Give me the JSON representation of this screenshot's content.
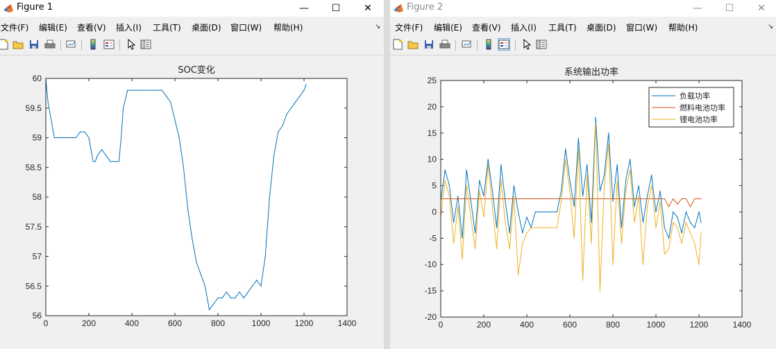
{
  "figure1": {
    "title": "Figure 1",
    "controls": {
      "minimize": "—",
      "maximize": "☐",
      "close": "✕"
    },
    "menu": [
      "文件(F)",
      "编辑(E)",
      "查看(V)",
      "插入(I)",
      "工具(T)",
      "桌面(D)",
      "窗口(W)",
      "帮助(H)"
    ],
    "toolbar_icons": [
      "new-file-icon",
      "open-folder-icon",
      "save-icon",
      "print-icon",
      "link-plot-icon",
      "colorbar-icon",
      "legend-icon",
      "edit-plot-arrow-icon",
      "property-inspector-icon"
    ]
  },
  "figure2": {
    "title": "Figure 2",
    "controls": {
      "minimize": "—",
      "maximize": "☐",
      "close": "✕"
    },
    "menu": [
      "文件(F)",
      "编辑(E)",
      "查看(V)",
      "插入(I)",
      "工具(T)",
      "桌面(D)",
      "窗口(W)",
      "帮助(H)"
    ],
    "toolbar_icons": [
      "new-file-icon",
      "open-folder-icon",
      "save-icon",
      "print-icon",
      "link-plot-icon",
      "colorbar-icon",
      "legend-icon",
      "edit-plot-arrow-icon",
      "property-inspector-icon"
    ]
  },
  "chart_data": [
    {
      "type": "line",
      "title": "SOC变化",
      "xlabel": "",
      "ylabel": "",
      "xlim": [
        0,
        1400
      ],
      "ylim": [
        56,
        60
      ],
      "xticks": [
        "0",
        "200",
        "400",
        "600",
        "800",
        "1000",
        "1200",
        "1400"
      ],
      "yticks": [
        "56",
        "56.5",
        "57",
        "57.5",
        "58",
        "58.5",
        "59",
        "59.5",
        "60"
      ],
      "grid": false,
      "series": [
        {
          "color": "#0072BD",
          "x": [
            0,
            5,
            10,
            20,
            40,
            80,
            100,
            120,
            140,
            160,
            180,
            200,
            210,
            220,
            230,
            240,
            260,
            280,
            300,
            320,
            340,
            350,
            360,
            380,
            400,
            450,
            500,
            540,
            560,
            580,
            600,
            620,
            640,
            660,
            680,
            700,
            720,
            740,
            760,
            780,
            800,
            820,
            840,
            860,
            880,
            900,
            920,
            940,
            960,
            980,
            1000,
            1020,
            1040,
            1060,
            1080,
            1100,
            1120,
            1140,
            1160,
            1180,
            1200,
            1210
          ],
          "y": [
            60,
            59.8,
            59.6,
            59.4,
            59.0,
            59.0,
            59.0,
            59.0,
            59.0,
            59.1,
            59.1,
            59.0,
            58.8,
            58.6,
            58.6,
            58.7,
            58.8,
            58.7,
            58.6,
            58.6,
            58.6,
            59.0,
            59.5,
            59.8,
            59.8,
            59.8,
            59.8,
            59.8,
            59.7,
            59.6,
            59.3,
            59.0,
            58.5,
            57.8,
            57.3,
            56.9,
            56.7,
            56.5,
            56.1,
            56.2,
            56.3,
            56.3,
            56.4,
            56.3,
            56.3,
            56.4,
            56.3,
            56.4,
            56.5,
            56.6,
            56.5,
            57.0,
            58.0,
            58.7,
            59.1,
            59.2,
            59.4,
            59.5,
            59.6,
            59.7,
            59.8,
            59.9
          ]
        }
      ]
    },
    {
      "type": "line",
      "title": "系统输出功率",
      "xlabel": "",
      "ylabel": "",
      "xlim": [
        0,
        1400
      ],
      "ylim": [
        -20,
        25
      ],
      "xticks": [
        "0",
        "200",
        "400",
        "600",
        "800",
        "1000",
        "1200",
        "1400"
      ],
      "yticks": [
        "-20",
        "-15",
        "-10",
        "-5",
        "0",
        "5",
        "10",
        "15",
        "20",
        "25"
      ],
      "grid": false,
      "legend_position": "top-right",
      "series": [
        {
          "name": "负载功率",
          "color": "#0072BD",
          "x": [
            0,
            20,
            40,
            60,
            80,
            100,
            120,
            140,
            160,
            180,
            200,
            220,
            240,
            260,
            280,
            300,
            320,
            340,
            360,
            380,
            400,
            420,
            440,
            540,
            560,
            580,
            600,
            620,
            640,
            660,
            680,
            700,
            720,
            740,
            760,
            780,
            800,
            820,
            840,
            860,
            880,
            900,
            920,
            940,
            960,
            980,
            1000,
            1020,
            1040,
            1060,
            1080,
            1100,
            1120,
            1140,
            1160,
            1180,
            1200,
            1210
          ],
          "y": [
            2,
            8,
            5,
            -2,
            3,
            -5,
            8,
            2,
            -4,
            6,
            3,
            10,
            4,
            -3,
            9,
            2,
            -4,
            5,
            0,
            -4,
            -1,
            -3,
            0,
            0,
            4,
            12,
            6,
            1,
            14,
            3,
            9,
            -2,
            18,
            4,
            7,
            15,
            2,
            9,
            -3,
            6,
            10,
            1,
            5,
            -2,
            3,
            7,
            0,
            4,
            -3,
            -5,
            0,
            -1,
            -4,
            0,
            -2,
            -3,
            0,
            -2
          ]
        },
        {
          "name": "燃料电池功率",
          "color": "#D95319",
          "x": [
            0,
            20,
            40,
            60,
            80,
            100,
            120,
            140,
            160,
            180,
            200,
            220,
            240,
            260,
            280,
            300,
            320,
            340,
            360,
            380,
            400,
            420,
            440,
            540,
            560,
            580,
            600,
            620,
            640,
            660,
            680,
            700,
            720,
            740,
            760,
            780,
            800,
            820,
            840,
            860,
            880,
            900,
            920,
            940,
            960,
            980,
            1000,
            1020,
            1040,
            1060,
            1080,
            1100,
            1120,
            1140,
            1160,
            1180,
            1200,
            1210
          ],
          "y": [
            2.5,
            2.5,
            2.5,
            2.5,
            2.5,
            2.5,
            2.5,
            2.5,
            2.5,
            2.5,
            2.5,
            2.5,
            2.5,
            2.5,
            2.5,
            2.5,
            2.5,
            2.5,
            2.5,
            2.5,
            2.5,
            2.5,
            2.5,
            2.5,
            2.5,
            2.5,
            2.5,
            2.5,
            2.5,
            2.5,
            2.5,
            2.5,
            2.5,
            2.5,
            2.5,
            2.5,
            2.5,
            2.5,
            2.5,
            2.5,
            2.5,
            2.5,
            2.5,
            2.5,
            2.5,
            2.5,
            2.5,
            2.5,
            2.5,
            1.0,
            2.5,
            1.5,
            2.5,
            2.5,
            1.0,
            2.5,
            2.5,
            2.5
          ]
        },
        {
          "name": "锂电池功率",
          "color": "#EDB120",
          "x": [
            0,
            20,
            40,
            60,
            80,
            100,
            120,
            140,
            160,
            180,
            200,
            220,
            240,
            260,
            280,
            300,
            320,
            340,
            360,
            380,
            400,
            420,
            440,
            540,
            560,
            580,
            600,
            620,
            640,
            660,
            680,
            700,
            720,
            740,
            760,
            780,
            800,
            820,
            840,
            860,
            880,
            900,
            920,
            940,
            960,
            980,
            1000,
            1020,
            1040,
            1060,
            1080,
            1100,
            1120,
            1140,
            1160,
            1180,
            1200,
            1210
          ],
          "y": [
            -1,
            6,
            3,
            -6,
            1,
            -9,
            5,
            -1,
            -7,
            4,
            -1,
            9,
            1,
            -7,
            6,
            -2,
            -7,
            3,
            -12,
            -6,
            -4,
            -3,
            -3,
            -3,
            2,
            10,
            4,
            -5,
            12,
            -13,
            7,
            -6,
            17,
            -15,
            5,
            13,
            -10,
            6,
            -6,
            4,
            8,
            -2,
            3,
            -10,
            1,
            5,
            -3,
            2,
            -8,
            -7,
            -2,
            -3,
            -6,
            -2,
            -4,
            -6,
            -10,
            -4
          ]
        }
      ]
    }
  ]
}
